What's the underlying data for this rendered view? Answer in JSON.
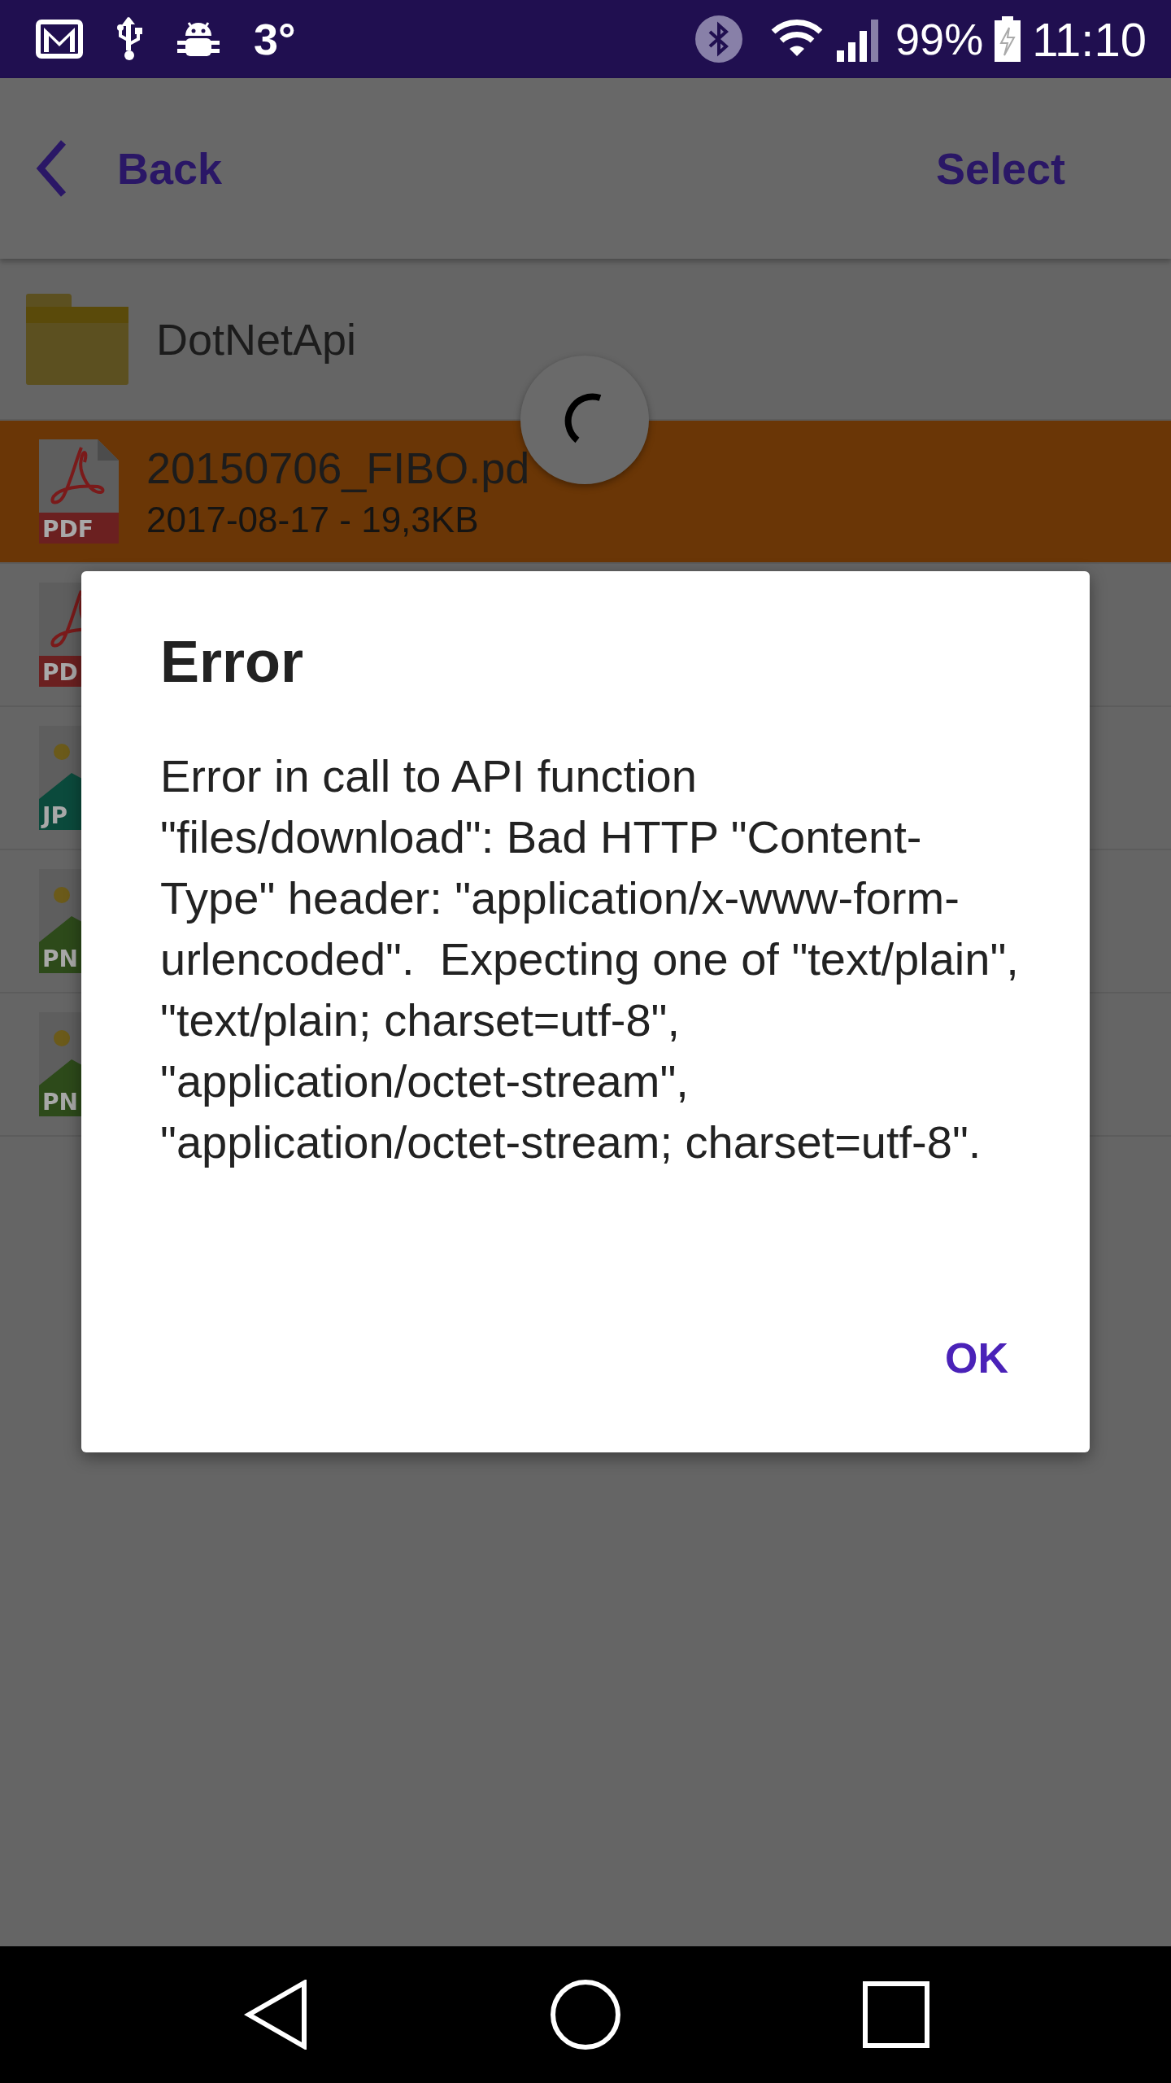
{
  "status_bar": {
    "temperature": "3°",
    "battery": "99%",
    "time": "11:10"
  },
  "toolbar": {
    "back": "Back",
    "select": "Select"
  },
  "files": [
    {
      "kind": "folder",
      "name": "DotNetApi",
      "selected": false
    },
    {
      "kind": "pdf",
      "name": "20150706_FIBO.pd",
      "badge": "PDF",
      "details": "2017-08-17 - 19,3KB",
      "selected": true
    },
    {
      "kind": "pdf",
      "badge": "PD",
      "selected": false
    },
    {
      "kind": "jpg",
      "badge": "JP",
      "selected": false
    },
    {
      "kind": "png",
      "badge": "PN",
      "selected": false
    },
    {
      "kind": "png",
      "badge": "PN",
      "selected": false
    }
  ],
  "dialog": {
    "title": "Error",
    "message": "Error in call to API function \"files/download\": Bad HTTP \"Content-Type\" header: \"application/x-www-form-urlencoded\".  Expecting one of \"text/plain\", \"text/plain; charset=utf-8\", \"application/octet-stream\", \"application/octet-stream; charset=utf-8\".",
    "button": "OK"
  }
}
